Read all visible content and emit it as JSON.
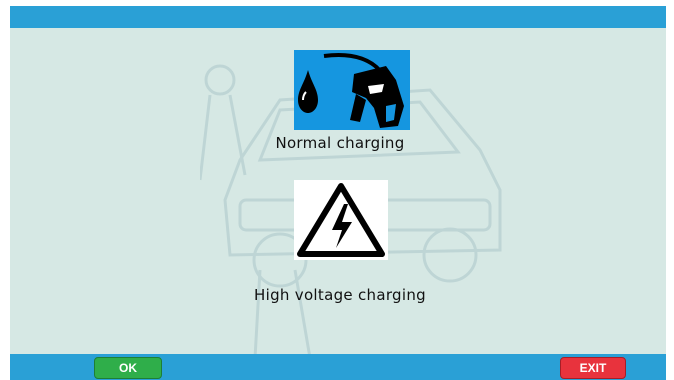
{
  "menu": {
    "items": [
      {
        "label": "Normal charging",
        "icon": "fuel-nozzle-icon"
      },
      {
        "label": "High voltage charging",
        "icon": "high-voltage-warning-icon"
      }
    ]
  },
  "footer": {
    "ok_label": "OK",
    "exit_label": "EXIT"
  },
  "colors": {
    "header_bar": "#2aa0d6",
    "content_bg": "#d6e8e4",
    "selected_icon_bg": "#1596e0",
    "ok_button": "#2fae4a",
    "exit_button": "#e8333d"
  }
}
